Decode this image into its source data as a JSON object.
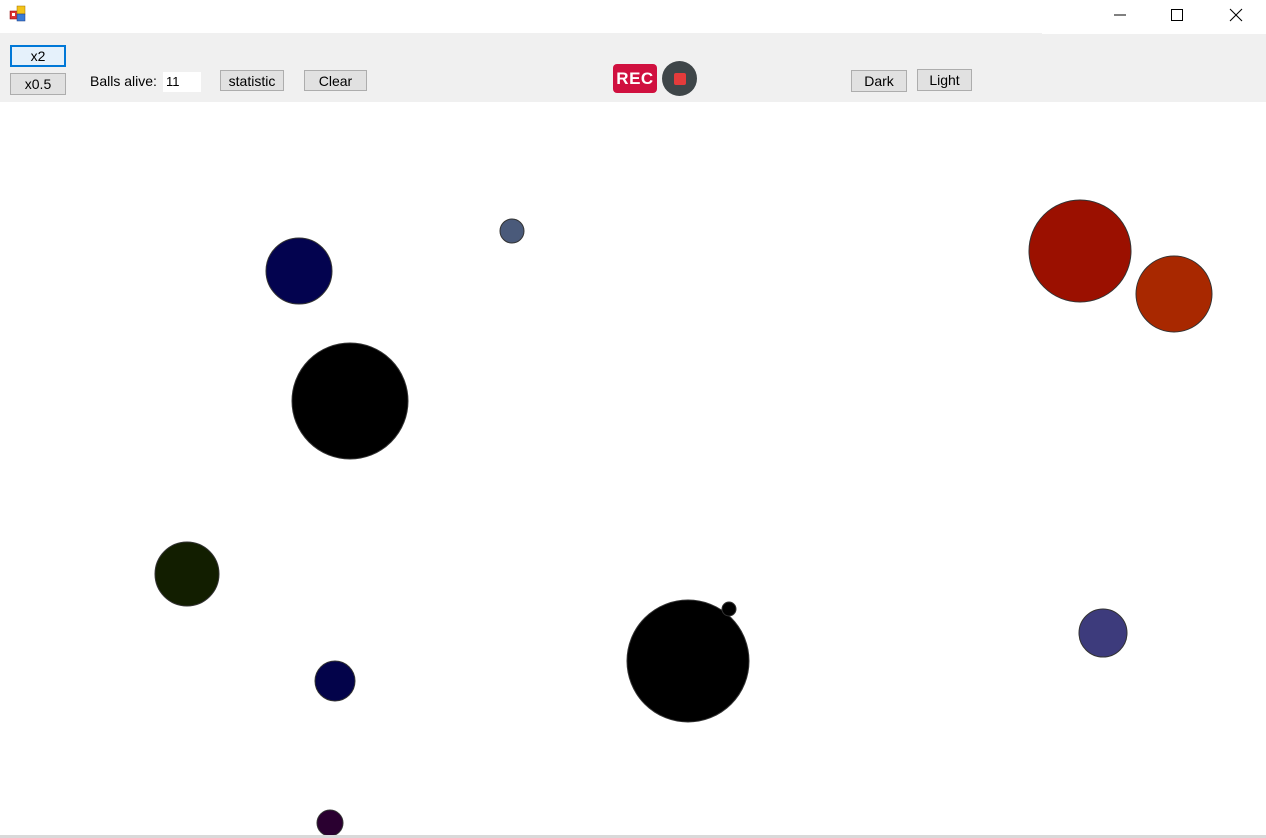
{
  "window": {
    "icon": "app-icon",
    "controls": {
      "minimize_icon": "minimize-icon",
      "maximize_icon": "maximize-icon",
      "close_icon": "close-icon"
    }
  },
  "toolbar": {
    "speed_up_label": "x2",
    "slow_down_label": "x0.5",
    "balls_alive_label": "Balls alive:",
    "balls_alive_value": "11",
    "statistic_label": "statistic",
    "clear_label": "Clear",
    "rec_label": "REC",
    "stop_icon": "stop-icon",
    "dark_label": "Dark",
    "light_label": "Light"
  },
  "canvas": {
    "background": "#ffffff",
    "balls": [
      {
        "color": "#03034f"
      },
      {
        "color": "#4a5a7a"
      },
      {
        "color": "#000000"
      },
      {
        "color": "#9b1000"
      },
      {
        "color": "#a82800"
      },
      {
        "color": "#121e00"
      },
      {
        "color": "#03034a"
      },
      {
        "color": "#000000"
      },
      {
        "color": "#000000"
      },
      {
        "color": "#3d3b7c"
      },
      {
        "color": "#2a0030"
      }
    ]
  }
}
